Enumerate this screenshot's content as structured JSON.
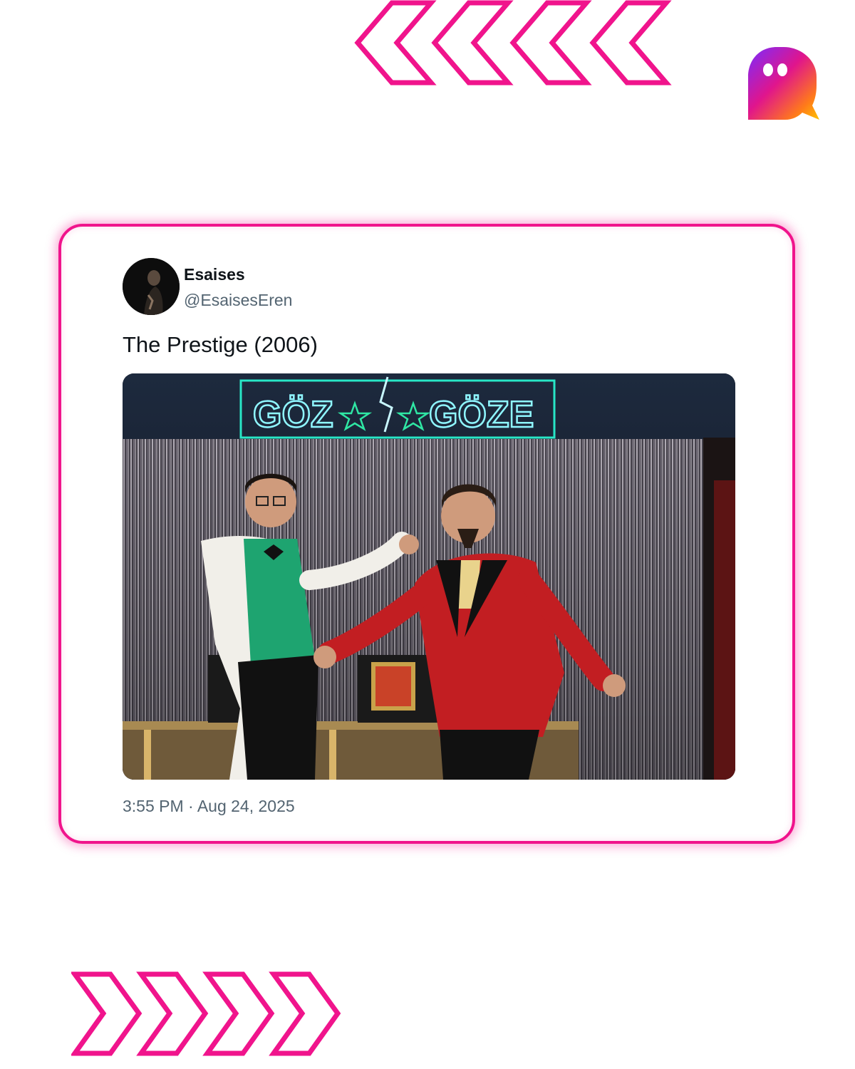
{
  "tweet": {
    "display_name": "Esaises",
    "handle": "@EsaisesEren",
    "text": "The Prestige (2006)",
    "timestamp": "3:55 PM · Aug 24, 2025",
    "media": {
      "sign_left": "GÖZ",
      "sign_right": "GÖZE"
    }
  },
  "decor": {
    "accent_color": "#f0148c",
    "top_chevrons": "chevron-left-icon",
    "bottom_chevrons": "chevron-right-icon",
    "logo_icon": "ghost-icon"
  }
}
